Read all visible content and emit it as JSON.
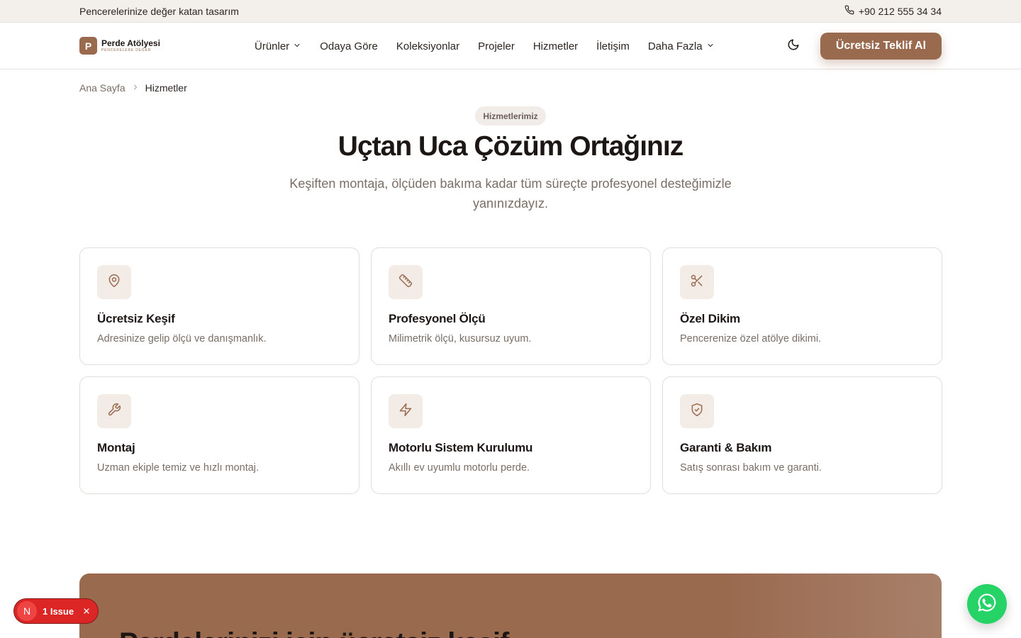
{
  "topbar": {
    "tagline": "Pencerelerinize değer katan tasarım",
    "phone": "+90 212 555 34 34"
  },
  "logo": {
    "mark": "P",
    "name": "Perde Atölyesi",
    "tagline": "PENCERELERE DEĞER"
  },
  "nav": {
    "items": [
      {
        "label": "Ürünler",
        "dropdown": true
      },
      {
        "label": "Odaya Göre",
        "dropdown": false
      },
      {
        "label": "Koleksiyonlar",
        "dropdown": false
      },
      {
        "label": "Projeler",
        "dropdown": false
      },
      {
        "label": "Hizmetler",
        "dropdown": false
      },
      {
        "label": "İletişim",
        "dropdown": false
      },
      {
        "label": "Daha Fazla",
        "dropdown": true
      }
    ],
    "theme_toggle_icon": "moon-icon",
    "cta_label": "Ücretsiz Teklif Al"
  },
  "breadcrumb": {
    "home": "Ana Sayfa",
    "current": "Hizmetler"
  },
  "hero": {
    "eyebrow": "Hizmetlerimiz",
    "title": "Uçtan Uca Çözüm Ortağınız",
    "subtitle": "Keşiften montaja, ölçüden bakıma kadar tüm süreçte profesyonel desteğimizle yanınızdayız."
  },
  "services": [
    {
      "icon": "map-pin-icon",
      "title": "Ücretsiz Keşif",
      "desc": "Adresinize gelip ölçü ve danışmanlık."
    },
    {
      "icon": "ruler-icon",
      "title": "Profesyonel Ölçü",
      "desc": "Milimetrik ölçü, kusursuz uyum."
    },
    {
      "icon": "scissors-icon",
      "title": "Özel Dikim",
      "desc": "Pencerenize özel atölye dikimi."
    },
    {
      "icon": "wrench-icon",
      "title": "Montaj",
      "desc": "Uzman ekiple temiz ve hızlı montaj."
    },
    {
      "icon": "lightning-icon",
      "title": "Motorlu Sistem Kurulumu",
      "desc": "Akıllı ev uyumlu motorlu perde."
    },
    {
      "icon": "shield-check-icon",
      "title": "Garanti & Bakım",
      "desc": "Satış sonrası bakım ve garanti."
    }
  ],
  "banner": {
    "title": "Perdelerinizi için ücretsiz keşif"
  },
  "issue_badge": {
    "initial": "N",
    "label": "1 Issue"
  },
  "colors": {
    "accent": "#9a6a4f",
    "icon_bg": "#f3ebe6",
    "whatsapp": "#25d366",
    "issue": "#dc2626"
  }
}
